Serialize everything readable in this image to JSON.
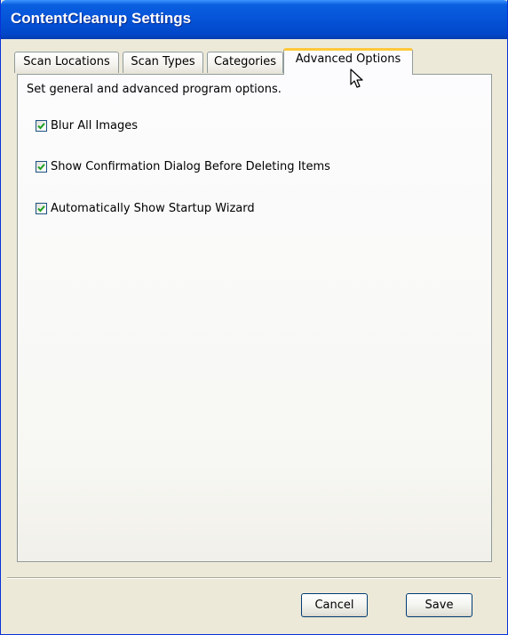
{
  "window": {
    "title": "ContentCleanup Settings"
  },
  "tabs": [
    {
      "label": "Scan Locations",
      "active": false
    },
    {
      "label": "Scan Types",
      "active": false
    },
    {
      "label": "Categories",
      "active": false
    },
    {
      "label": "Advanced Options",
      "active": true
    }
  ],
  "advanced_options": {
    "description": "Set general and advanced program options.",
    "options": [
      {
        "label": "Blur All Images",
        "checked": true
      },
      {
        "label": "Show Confirmation Dialog Before Deleting Items",
        "checked": true
      },
      {
        "label": "Automatically Show Startup Wizard",
        "checked": true
      }
    ]
  },
  "buttons": {
    "cancel_label": "Cancel",
    "save_label": "Save"
  },
  "icons": {
    "checkmark": "checkmark-icon",
    "cursor": "mouse-pointer-icon"
  },
  "colors": {
    "titlebar": "#0553d8",
    "dialog_background": "#ece9d8",
    "active_tab_highlight": "#ffc83c",
    "checkmark": "#21a121"
  }
}
